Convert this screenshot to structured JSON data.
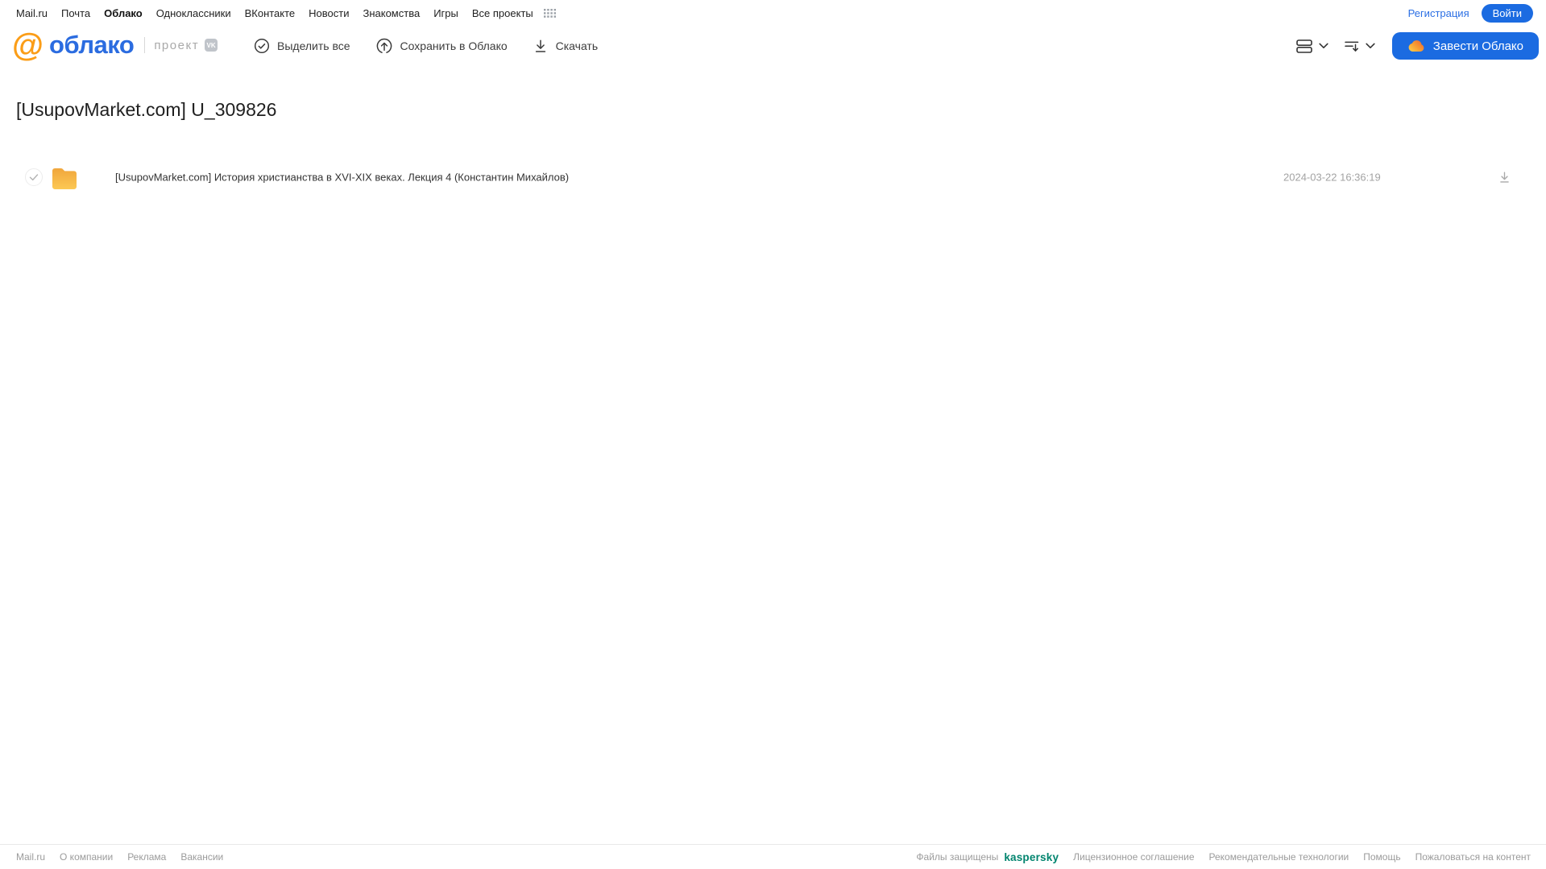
{
  "topnav": {
    "items": [
      "Mail.ru",
      "Почта",
      "Облако",
      "Одноклассники",
      "ВКонтакте",
      "Новости",
      "Знакомства",
      "Игры",
      "Все проекты"
    ],
    "active_item": "Облако",
    "registration_link": "Регистрация",
    "login_button": "Войти"
  },
  "header": {
    "logo": {
      "at_symbol": "@",
      "product_name": "облако",
      "project_label": "проект",
      "vk_badge": "VK"
    },
    "toolbar": {
      "select_all": "Выделить все",
      "save_to_cloud": "Сохранить в Облако",
      "download": "Скачать"
    },
    "create_cloud_button": "Завести Облако"
  },
  "main": {
    "page_title": "[UsupovMarket.com] U_309826",
    "files": [
      {
        "type": "folder",
        "name": "[UsupovMarket.com] История христианства в XVI-XIX веках. Лекция 4 (Константин Михайлов)",
        "modified": "2024-03-22 16:36:19"
      }
    ]
  },
  "footer": {
    "links_left": [
      "Mail.ru",
      "О компании",
      "Реклама",
      "Вакансии"
    ],
    "protected_by_label": "Файлы защищены",
    "kaspersky_logo": "kaspersky",
    "links_right": [
      "Лицензионное соглашение",
      "Рекомендательные технологии",
      "Помощь",
      "Пожаловаться на контент"
    ]
  },
  "colors": {
    "primary_blue": "#1b6be1",
    "logo_blue": "#2b6ce0",
    "logo_orange": "#fb9d17",
    "folder_gradient_top": "#f0a63c",
    "folder_gradient_bottom": "#fcc854",
    "kaspersky_green": "#00846e",
    "text_dark": "#222222",
    "text_grey": "#9b9b9b"
  }
}
